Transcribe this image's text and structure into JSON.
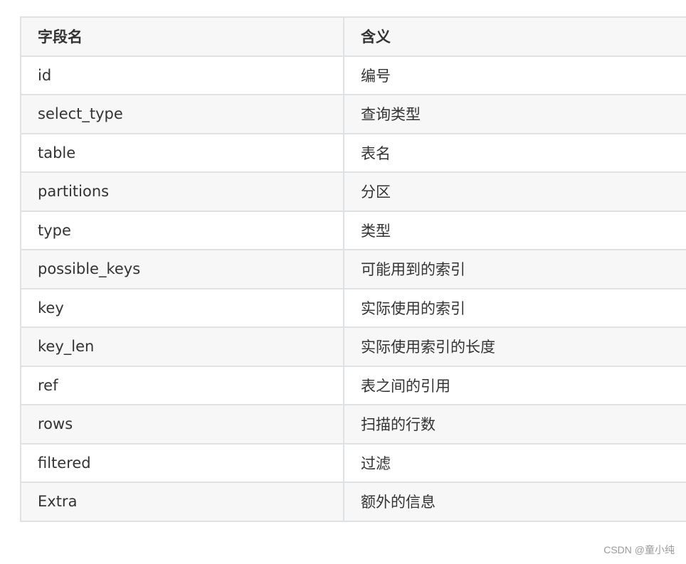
{
  "table": {
    "headers": [
      "字段名",
      "含义"
    ],
    "rows": [
      [
        "id",
        "编号"
      ],
      [
        "select_type",
        "查询类型"
      ],
      [
        "table",
        "表名"
      ],
      [
        "partitions",
        "分区"
      ],
      [
        "type",
        "类型"
      ],
      [
        "possible_keys",
        "可能用到的索引"
      ],
      [
        "key",
        "实际使用的索引"
      ],
      [
        "key_len",
        "实际使用索引的长度"
      ],
      [
        "ref",
        "表之间的引用"
      ],
      [
        "rows",
        "扫描的行数"
      ],
      [
        "filtered",
        "过滤"
      ],
      [
        "Extra",
        "额外的信息"
      ]
    ]
  },
  "watermark": "CSDN @童小纯",
  "colors": {
    "border": "#dfe2e5",
    "shaded_row": "#f7f7f7",
    "text": "#333333"
  }
}
